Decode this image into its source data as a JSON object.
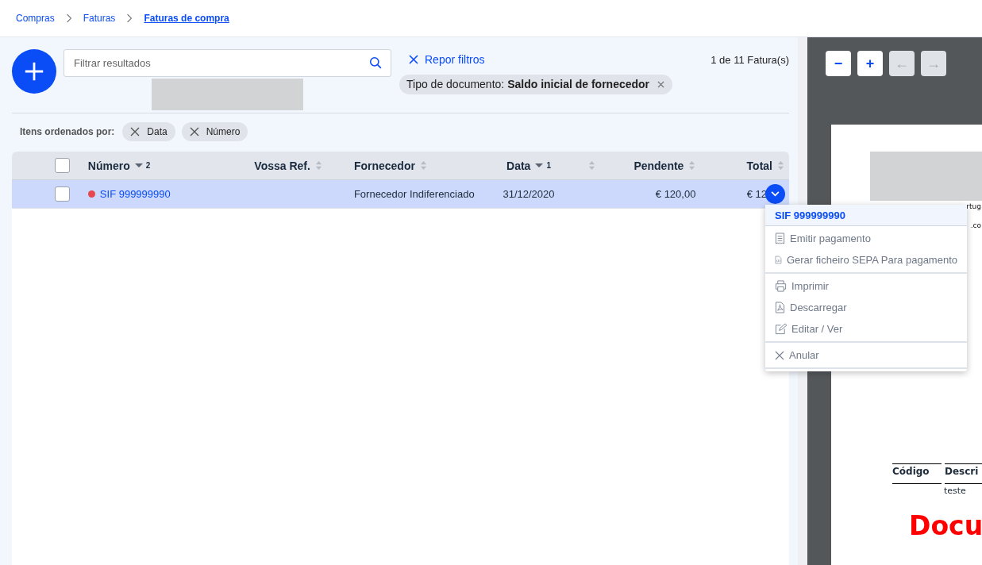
{
  "breadcrumb": [
    {
      "label": "Compras",
      "current": false
    },
    {
      "label": "Faturas",
      "current": false
    },
    {
      "label": "Faturas de compra",
      "current": true
    }
  ],
  "search": {
    "placeholder": "Filtrar resultados"
  },
  "reset_filters": "Repor filtros",
  "count": "1 de 11 Fatura(s)",
  "filter_chip": {
    "label": "Tipo de documento: **Saldo inicial de fornecedor**"
  },
  "sort_label": "Itens ordenados por:",
  "sort_chips": [
    "Data",
    "Número"
  ],
  "table": {
    "select_all": {
      "checked": false
    },
    "columns": [
      {
        "label": "Número",
        "sorted": true,
        "order": "2"
      },
      {
        "label": "Vossa Ref.",
        "sorted": false
      },
      {
        "label": "Fornecedor",
        "sorted": false
      },
      {
        "label": "Data",
        "sorted": true,
        "order": "1"
      },
      {
        "sorted": false
      },
      {
        "label": "Pendente",
        "sorted": false
      },
      {
        "label": "Total",
        "sorted": false
      }
    ],
    "rows": [
      {
        "selected": true,
        "checked": false,
        "color": "#e5484d",
        "number": "SIF 999999990",
        "supplier": "Fornecedor Indiferenciado",
        "date": "31/12/2020",
        "pending": "€ 120,00",
        "total": "€ 12"
      }
    ]
  },
  "menu": {
    "title": "SIF 999999990",
    "groups": [
      [
        {
          "label": "Emitir pagamento"
        },
        {
          "label": "Gerar ficheiro SEPA Para pagamento"
        }
      ],
      [
        {
          "label": "Imprimir"
        },
        {
          "label": "Descarregar"
        },
        {
          "label": "Editar / Ver"
        }
      ],
      [
        {
          "label": "Anular"
        }
      ]
    ]
  },
  "viewer": {
    "toolbar": [
      {
        "label": "−",
        "disabled": false
      },
      {
        "label": "+",
        "disabled": false
      },
      {
        "label": "←",
        "disabled": true
      },
      {
        "label": "→",
        "disabled": true
      }
    ],
    "fragments": [
      "rtug",
      ".co"
    ],
    "table_headers": [
      "Código",
      "Descri"
    ],
    "cell": "teste",
    "watermark": "Docu"
  }
}
